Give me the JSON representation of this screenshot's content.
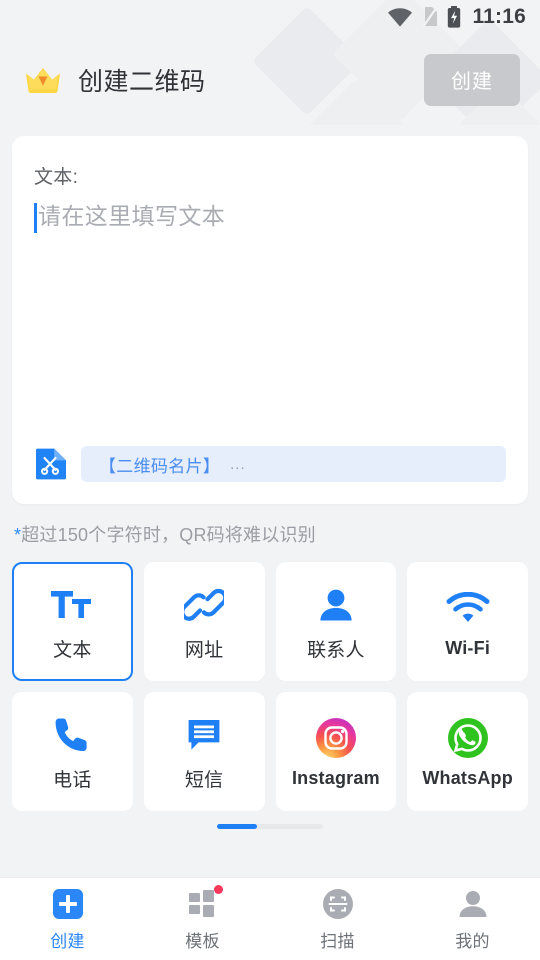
{
  "statusbar": {
    "time": "11:16",
    "icons": [
      "wifi-icon",
      "no-sim-icon",
      "battery-charging-icon"
    ]
  },
  "header": {
    "logo_icon": "crown-icon",
    "title": "创建二维码",
    "action_label": "创建",
    "action_enabled": false,
    "action_bg": "#c8c9cc"
  },
  "text_card": {
    "field_label": "文本:",
    "input_value": "",
    "placeholder": "请在这里填写文本",
    "suggestion": {
      "icon": "clipboard-scissors-icon",
      "text": "【二维码名片】",
      "ellipsis": "..."
    }
  },
  "hint": {
    "star": "*",
    "text": "超过150个字符时，QR码将难以识别"
  },
  "types": [
    {
      "label": "文本",
      "icon": "text-format-icon",
      "selected": true,
      "latin": false
    },
    {
      "label": "网址",
      "icon": "link-icon",
      "selected": false,
      "latin": false
    },
    {
      "label": "联系人",
      "icon": "person-icon",
      "selected": false,
      "latin": false
    },
    {
      "label": "Wi-Fi",
      "icon": "wifi-icon",
      "selected": false,
      "latin": true
    },
    {
      "label": "电话",
      "icon": "phone-icon",
      "selected": false,
      "latin": false
    },
    {
      "label": "短信",
      "icon": "message-icon",
      "selected": false,
      "latin": false
    },
    {
      "label": "Instagram",
      "icon": "instagram-icon",
      "selected": false,
      "latin": true
    },
    {
      "label": "WhatsApp",
      "icon": "whatsapp-icon",
      "selected": false,
      "latin": true
    }
  ],
  "scroll_indicator": {
    "position_percent": 0,
    "thumb_percent": 38
  },
  "bottomnav": [
    {
      "label": "创建",
      "icon": "plus-square-icon",
      "active": true,
      "badge": false
    },
    {
      "label": "模板",
      "icon": "grid-icon",
      "active": false,
      "badge": true
    },
    {
      "label": "扫描",
      "icon": "scan-icon",
      "active": false,
      "badge": false
    },
    {
      "label": "我的",
      "icon": "person-icon",
      "active": false,
      "badge": false
    }
  ],
  "colors": {
    "accent": "#1f7ff5",
    "page_bg": "#f2f3f5",
    "card_bg": "#ffffff",
    "badge": "#f7385b"
  }
}
